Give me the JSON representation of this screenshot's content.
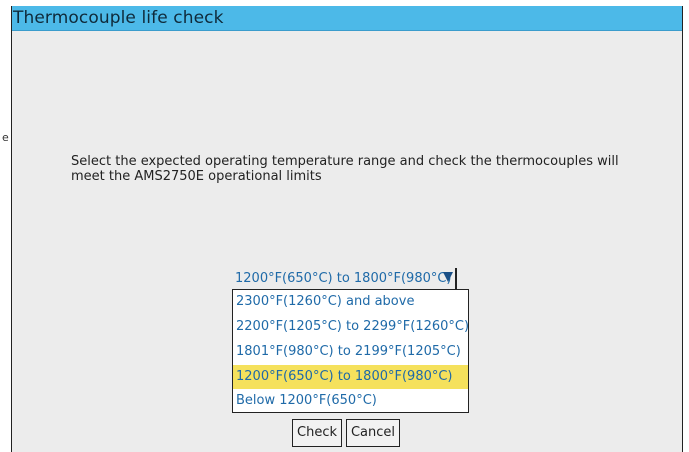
{
  "dialog": {
    "title": "Thermocouple life check",
    "prompt": "Select the expected operating temperature range and check the thermocouples will meet the AMS2750E operational limits"
  },
  "edge_mark": "e",
  "range_select": {
    "selected_value": "1200°F(650°C) to 1800°F(980°C)",
    "options": [
      "2300°F(1260°C) and above",
      "2200°F(1205°C) to 2299°F(1260°C)",
      "1801°F(980°C) to 2199°F(1205°C)",
      "1200°F(650°C) to 1800°F(980°C)",
      "Below 1200°F(650°C)"
    ],
    "highlighted_index": 3,
    "highlight_color": "#f5e15c"
  },
  "buttons": {
    "check_label": "Check",
    "cancel_label": "Cancel"
  },
  "colors": {
    "titlebar": "#4cb9e8",
    "background": "#ececec",
    "option_text": "#1f6aa8"
  }
}
